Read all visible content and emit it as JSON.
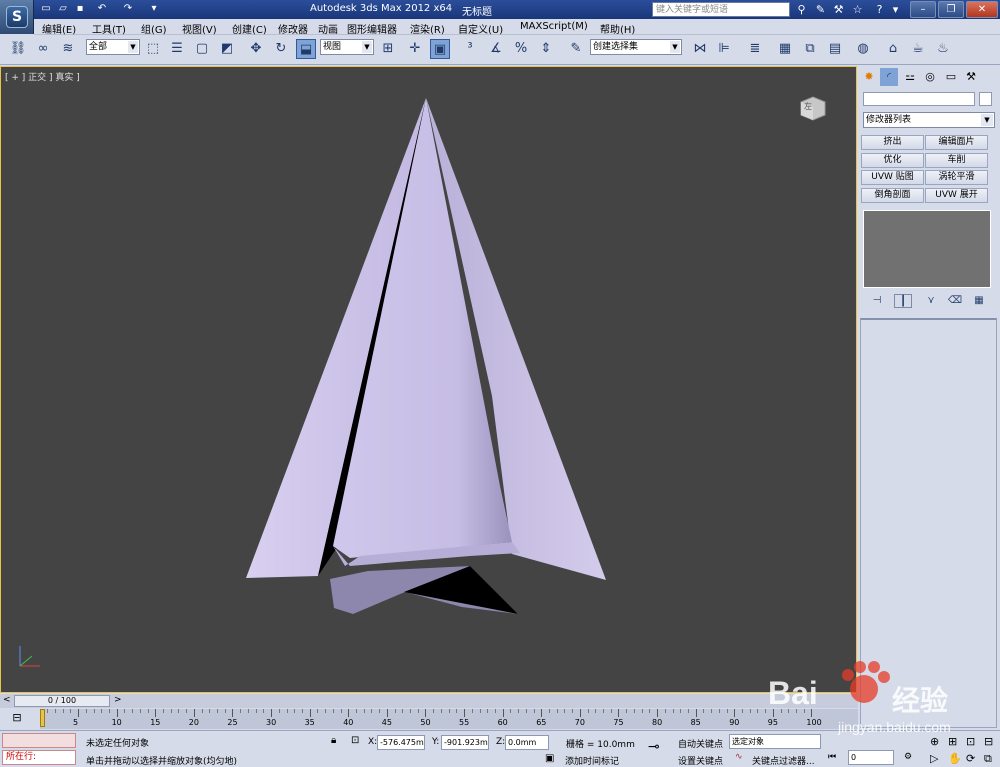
{
  "app": {
    "title": "Autodesk 3ds Max  2012 x64",
    "document": "无标题",
    "search_placeholder": "键入关键字或短语",
    "logo_letter": "S"
  },
  "menu": [
    "编辑(E)",
    "工具(T)",
    "组(G)",
    "视图(V)",
    "创建(C)",
    "修改器",
    "动画",
    "图形编辑器",
    "渲染(R)",
    "自定义(U)",
    "MAXScript(M)",
    "帮助(H)"
  ],
  "toolbar": {
    "selection_filter": "全部",
    "ref_coord": "视图",
    "named_selection": "创建选择集"
  },
  "viewport": {
    "label": "[ + ] 正交 ] 真实 ]",
    "viewcube_label": "左",
    "colors": {
      "bg": "#444444",
      "mesh": "#c9bfe6",
      "mesh_dark": "#8e86ad",
      "shadow": "#000000"
    }
  },
  "command_panel": {
    "modifier_list": "修改器列表",
    "modifier_buttons": [
      "挤出",
      "编辑面片",
      "优化",
      "车削",
      "UVW 贴图",
      "涡轮平滑",
      "倒角剖面",
      "UVW 展开"
    ]
  },
  "time": {
    "slider": "0 / 100",
    "ticks": [
      "5",
      "10",
      "15",
      "20",
      "25",
      "30",
      "35",
      "40",
      "45",
      "50",
      "55",
      "60",
      "65",
      "70",
      "75",
      "80",
      "85",
      "90",
      "95",
      "100"
    ],
    "current_frame": "0"
  },
  "status": {
    "line1": "未选定任何对象",
    "line2": "单击并拖动以选择并缩放对象(均匀地)",
    "script_label": "所在行:",
    "x_label": "X:",
    "x": "-576.475m",
    "y_label": "Y:",
    "y": "-901.923m",
    "z_label": "Z:",
    "z": "0.0mm",
    "grid": "栅格 = 10.0mm",
    "add_time_tag": "添加时间标记",
    "auto_key": "自动关键点",
    "set_key": "设置关键点",
    "key_mode": "选定对象",
    "key_filters": "关键点过滤器..."
  },
  "watermark": {
    "brand": "Bai",
    "brand2": "经验",
    "url": "jingyan.baidu.com"
  }
}
